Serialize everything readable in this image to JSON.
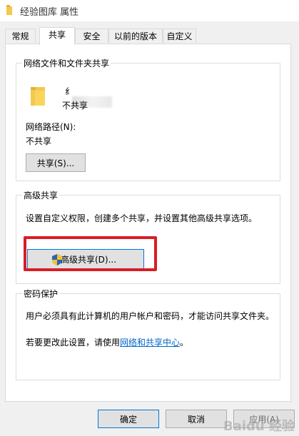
{
  "window": {
    "title": "经验图库 属性"
  },
  "tabs": [
    {
      "label": "常规"
    },
    {
      "label": "共享"
    },
    {
      "label": "安全"
    },
    {
      "label": "以前的版本"
    },
    {
      "label": "自定义"
    }
  ],
  "network_share": {
    "group_title": "网络文件和文件夹共享",
    "folder_name": "纟",
    "folder_status": "不共享",
    "path_label": "网络路径(N):",
    "path_value": "不共享",
    "share_button": "共享(S)..."
  },
  "advanced_share": {
    "group_title": "高级共享",
    "description": "设置自定义权限，创建多个共享，并设置其他高级共享选项。",
    "button": "高级共享(D)..."
  },
  "password": {
    "group_title": "密码保护",
    "description": "用户必须具有此计算机的用户帐户和密码，才能访问共享文件夹。",
    "change_prefix": "若要更改此设置，请使用",
    "change_link": "网络和共享中心",
    "change_suffix": "。"
  },
  "footer": {
    "ok": "确定",
    "cancel": "取消",
    "apply": "应用(A)"
  },
  "watermark": "Baidu 经验",
  "colors": {
    "highlight": "#d81e24",
    "link": "#0066cc",
    "focus": "#0078d7",
    "folder": "#f2c94c"
  }
}
